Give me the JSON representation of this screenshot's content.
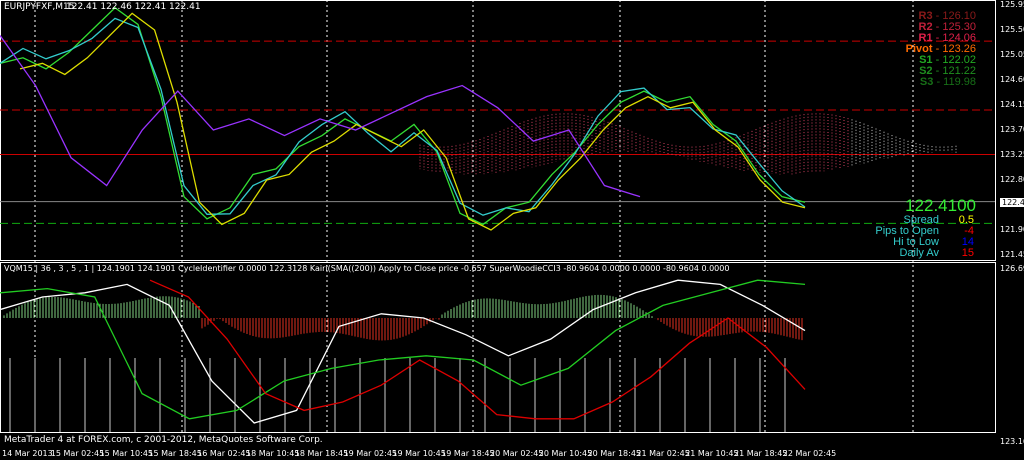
{
  "header": {
    "symbol": "EURJPYFXF,M15",
    "ohlc": "122.41 122.46 122.41 122.41"
  },
  "pivots": [
    {
      "label": "R3",
      "value": "126.10",
      "color": "#8b1a1a"
    },
    {
      "label": "R2",
      "value": "125.30",
      "color": "#c0203a"
    },
    {
      "label": "R1",
      "value": "124.06",
      "color": "#e0204a"
    },
    {
      "label": "Pivot",
      "value": "123.26",
      "color": "#ff6a00"
    },
    {
      "label": "S1",
      "value": "122.02",
      "color": "#22aa22"
    },
    {
      "label": "S2",
      "value": "121.22",
      "color": "#1f8f1f"
    },
    {
      "label": "S3",
      "value": "119.98",
      "color": "#176f17"
    }
  ],
  "info": {
    "price": "122.4100",
    "rows": [
      {
        "label": "Spread",
        "value": "0.5",
        "valcolor": "#ffff00"
      },
      {
        "label": "Pips to Open",
        "value": "-4",
        "valcolor": "#ff0000"
      },
      {
        "label": "Hi to Low",
        "value": "14",
        "valcolor": "#0000ff"
      },
      {
        "label": "Daily Av",
        "value": "15",
        "valcolor": "#ff0000"
      }
    ]
  },
  "price_axis": [
    "125.95",
    "125.50",
    "125.05",
    "124.60",
    "124.15",
    "123.70",
    "123.25",
    "122.80",
    "121.90",
    "121.45"
  ],
  "current_price_tag": "122.41",
  "sub": {
    "header": "VQM15 | 36 , 3 , 5 , 1 | 124.1901 124.1901  CycleIdentifier 0.0000 122.3128  Kairi(SMA((200)) Apply to Close price -0.657  SuperWoodieCCI3 -80.9604 0.0000 0.0000 -80.9604 0.0000",
    "axis_top": "126.696",
    "axis_bottom": "123.163"
  },
  "copyright": "MetaTrader 4 at FOREX.com, c 2001-2012, MetaQuotes Software Corp.",
  "time_axis": [
    "14 Mar 2013",
    "15 Mar 02:45",
    "15 Mar 10:45",
    "15 Mar 18:45",
    "16 Mar 02:45",
    "18 Mar 10:45",
    "18 Mar 18:45",
    "19 Mar 02:45",
    "19 Mar 10:45",
    "19 Mar 18:45",
    "20 Mar 02:45",
    "20 Mar 10:45",
    "20 Mar 18:45",
    "21 Mar 02:45",
    "21 Mar 10:45",
    "21 Mar 18:45",
    "22 Mar 02:45"
  ],
  "chart_data": {
    "type": "line",
    "title": "EURJPY M15",
    "ylim": [
      121.3,
      126.0
    ],
    "levels": {
      "R2": 125.3,
      "R1": 124.06,
      "Pivot": 123.26,
      "S1": 122.02,
      "current": 122.41
    },
    "series": [
      {
        "name": "close",
        "color": "#33dd33",
        "values": [
          124.9,
          125.0,
          124.8,
          125.1,
          125.5,
          125.9,
          125.6,
          124.3,
          122.5,
          122.1,
          122.3,
          122.9,
          123.0,
          123.4,
          123.6,
          123.9,
          123.7,
          123.5,
          123.8,
          123.3,
          122.2,
          122.0,
          122.3,
          122.4,
          122.9,
          123.3,
          123.8,
          124.2,
          124.4,
          124.2,
          124.3,
          123.8,
          123.5,
          122.9,
          122.5,
          122.4
        ]
      },
      {
        "name": "purple",
        "color": "#9933ff",
        "values": [
          125.4,
          124.5,
          123.2,
          122.7,
          123.7,
          124.4,
          123.7,
          123.9,
          123.6,
          123.9,
          123.7,
          124.0,
          124.3,
          124.5,
          124.1,
          123.5,
          123.7,
          122.7,
          122.5
        ]
      },
      {
        "name": "sub_white",
        "color": "#ffffff",
        "values": [
          0.2,
          0.5,
          0.6,
          0.8,
          0.3,
          -1.5,
          -2.5,
          -2.2,
          -0.2,
          0.1,
          0.0,
          -0.4,
          -0.9,
          -0.5,
          0.2,
          0.6,
          0.9,
          0.8,
          0.3,
          -0.3
        ]
      },
      {
        "name": "sub_green",
        "color": "#22cc22",
        "values": [
          0.6,
          0.7,
          0.5,
          -1.8,
          -2.4,
          -2.2,
          -1.5,
          -1.2,
          -1.0,
          -0.9,
          -1.0,
          -1.6,
          -1.2,
          -0.3,
          0.3,
          0.6,
          0.9,
          0.8
        ]
      },
      {
        "name": "sub_red",
        "color": "#dd0000",
        "values": [
          0.9,
          0.5,
          -0.5,
          -1.8,
          -2.2,
          -2.0,
          -1.6,
          -1.0,
          -1.5,
          -2.3,
          -2.4,
          -2.4,
          -2.0,
          -1.4,
          -0.6,
          0.0,
          -0.7,
          -1.7
        ]
      }
    ]
  }
}
